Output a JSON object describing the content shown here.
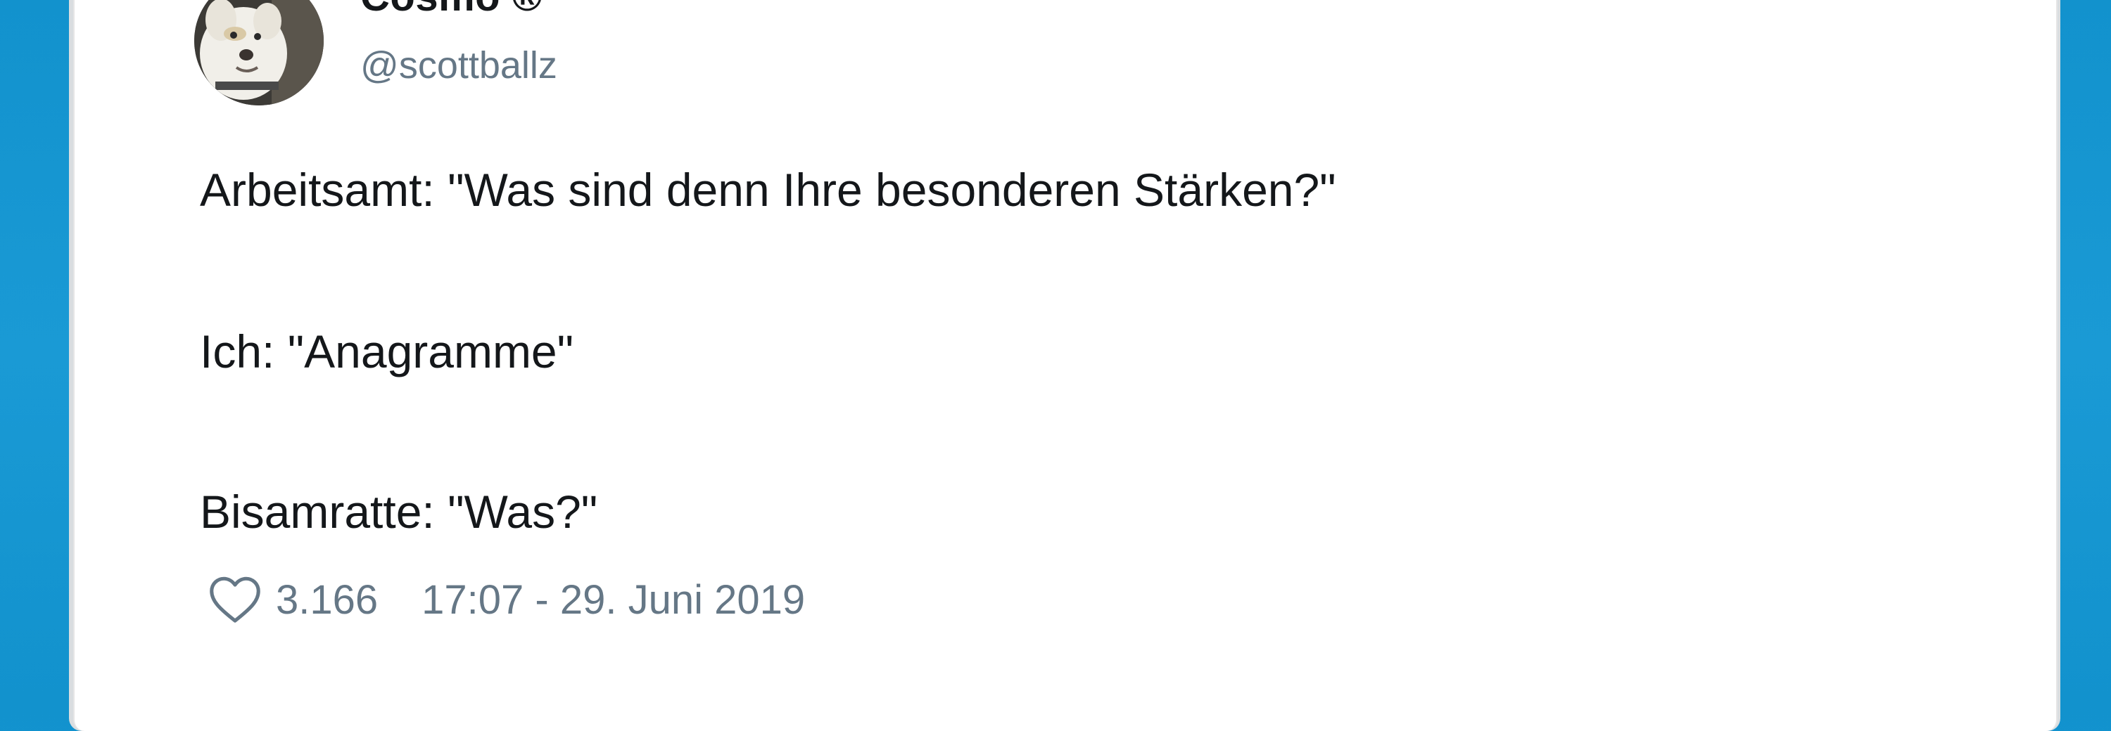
{
  "tweet": {
    "display_name": "Cosmo ®",
    "handle": "@scottballz",
    "avatar_icon": "dog-avatar-icon",
    "text_lines": [
      "Arbeitsamt: \"Was sind denn Ihre besonderen Stärken?\"",
      "Ich: \"Anagramme\"",
      "Bisamratte: \"Was?\""
    ],
    "likes_icon": "heart-icon",
    "likes": "3.166",
    "timestamp": "17:07 - 29. Juni 2019"
  },
  "colors": {
    "background": "#1a9ad5",
    "card": "#ffffff",
    "text": "#14171a",
    "muted": "#657786"
  }
}
